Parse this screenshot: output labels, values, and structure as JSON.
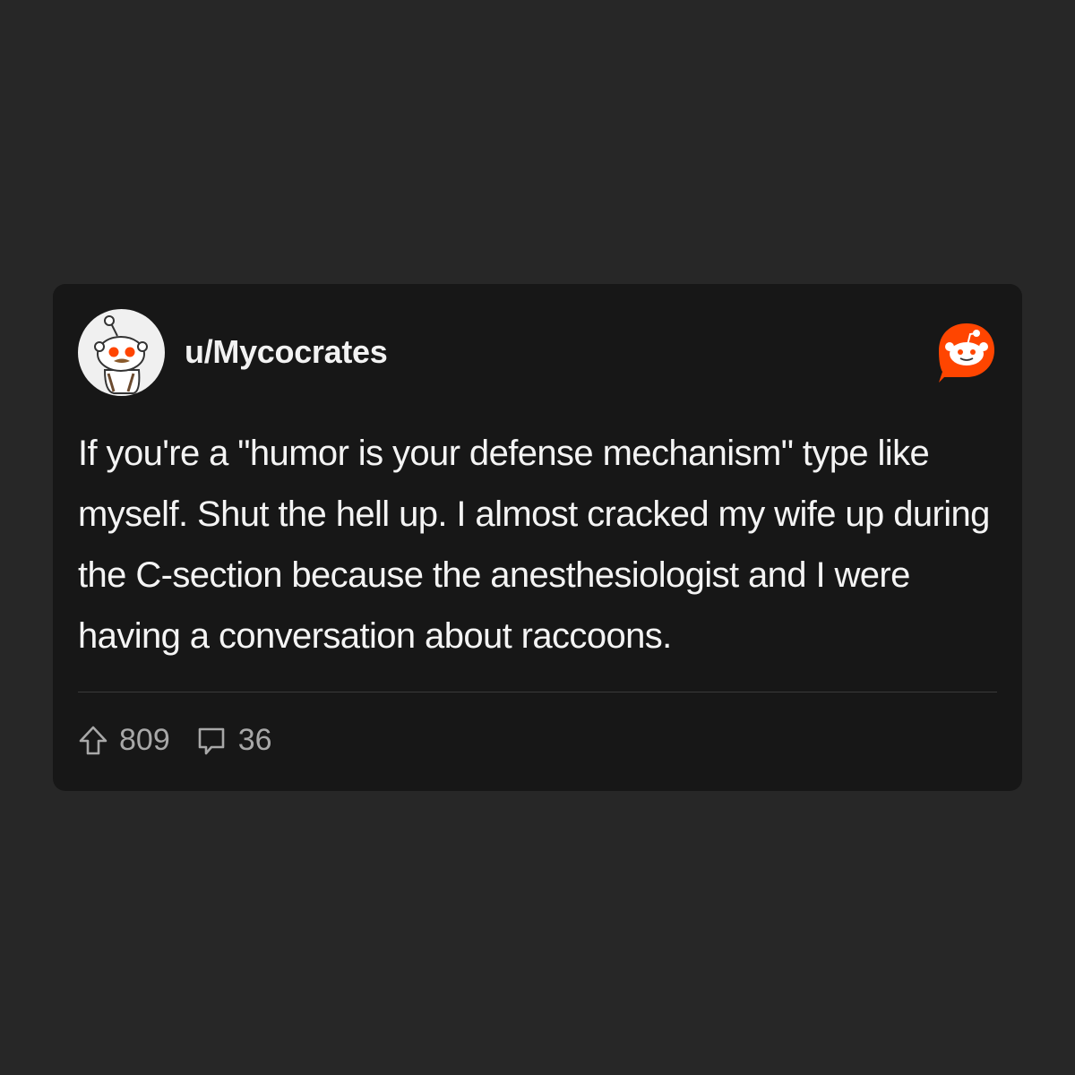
{
  "post": {
    "username": "u/Mycocrates",
    "body": "If you're a \"humor is your defense mechanism\" type like myself. Shut the hell up. I almost cracked my wife up during the C-section because the anesthesiologist and I were having a conversation about raccoons.",
    "upvotes": "809",
    "comments": "36"
  },
  "icons": {
    "avatar": "snoo-avatar-icon",
    "brand": "reddit-logo-icon",
    "upvote": "upvote-arrow-icon",
    "comment": "comment-bubble-icon"
  },
  "colors": {
    "background": "#272727",
    "card": "#171717",
    "brand": "#ff4500",
    "text": "#f4f4f4",
    "muted": "#a8a8a8"
  }
}
